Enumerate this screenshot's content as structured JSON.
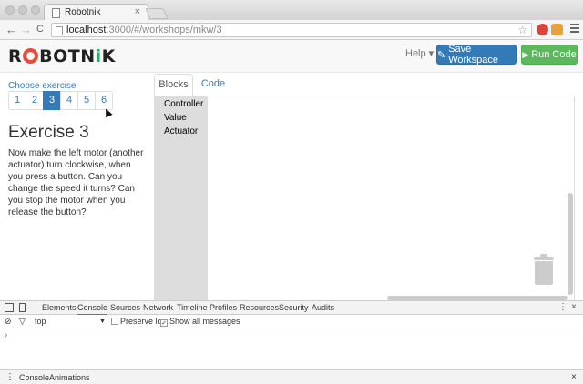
{
  "browser": {
    "tab_title": "Robotnik",
    "tab_close": "×",
    "url_host": "localhost",
    "url_path": ":3000/#/workshops/mkw/3",
    "back": "←",
    "forward": "→",
    "reload": "C",
    "bookmark_star": "☆"
  },
  "navbar": {
    "logo_pre": "R",
    "logo_mid": "BOTN",
    "logo_i": "i",
    "logo_post": "K",
    "help_label": "Help ▾",
    "save_icon": "✎",
    "save_label": "Save Workspace",
    "run_icon": "▶",
    "run_label": "Run Code"
  },
  "exercise": {
    "choose_label": "Choose exercise",
    "pages": [
      "1",
      "2",
      "3",
      "4",
      "5",
      "6"
    ],
    "active_page": "3",
    "title": "Exercise 3",
    "text": "Now make the left motor (another actuator) turn clockwise, when you press a button. Can you change the speed it turns? Can you stop the motor when you release the button?"
  },
  "editor": {
    "tabs": [
      "Blocks",
      "Code"
    ],
    "toolbox": [
      "Controller",
      "Value",
      "Actuator"
    ]
  },
  "devtools": {
    "tabs": [
      "Elements",
      "Console",
      "Sources",
      "Network",
      "Timeline",
      "Profiles",
      "Resources",
      "Security",
      "Audits"
    ],
    "active_tab": "Console",
    "context": "top",
    "context_caret": "▼",
    "preserve_log": "Preserve log",
    "show_all": "Show all messages",
    "prompt": "›",
    "drawer_tabs": [
      "Console",
      "Animations"
    ],
    "close": "×",
    "more": "⋮"
  },
  "colors": {
    "primary": "#337ab7",
    "success": "#5cb85c",
    "logo_red": "#e74c3c",
    "logo_green": "#27ae60"
  }
}
